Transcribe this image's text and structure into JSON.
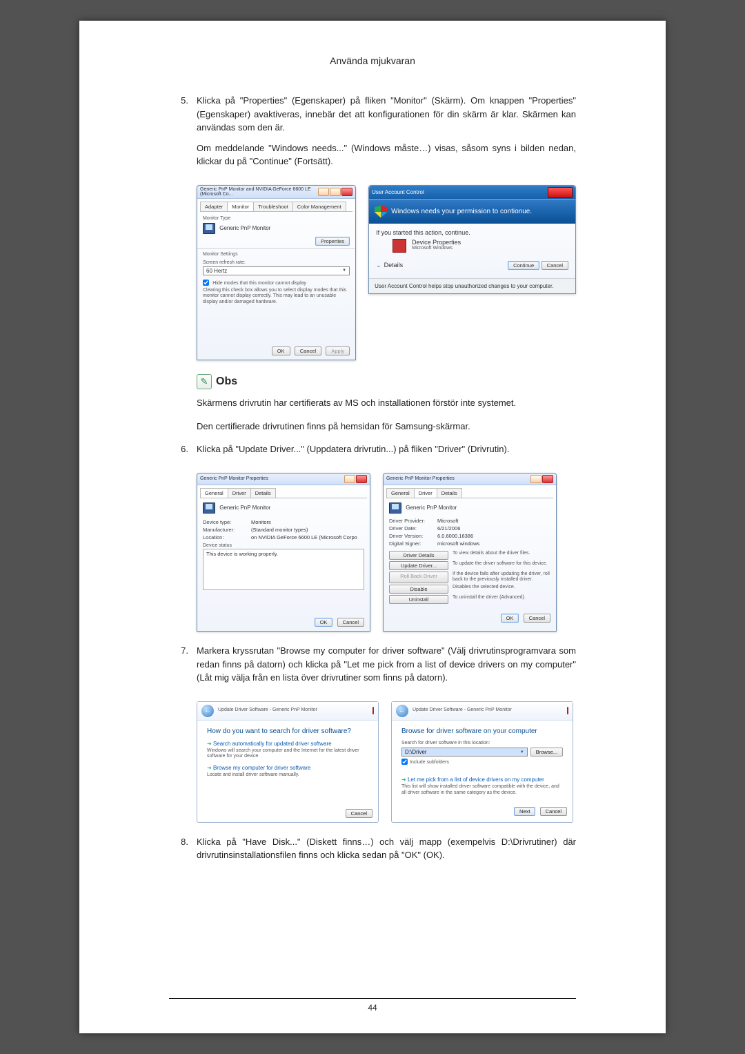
{
  "header": {
    "title": "Använda mjukvaran"
  },
  "steps": {
    "s5": {
      "num": "5.",
      "p1": "Klicka på \"Properties\" (Egenskaper) på fliken \"Monitor\" (Skärm). Om knappen \"Properties\" (Egenskaper) avaktiveras, innebär det att konfigurationen för din skärm är klar. Skärmen kan användas som den är.",
      "p2": "Om meddelande \"Windows needs...\" (Windows måste…) visas, såsom syns i bilden nedan, klickar du på \"Continue\" (Fortsätt)."
    },
    "s6": {
      "num": "6.",
      "p1": "Klicka på \"Update Driver...\" (Uppdatera drivrutin...) på fliken \"Driver\" (Drivrutin)."
    },
    "s7": {
      "num": "7.",
      "p1": "Markera kryssrutan \"Browse my computer for driver software\" (Välj drivrutinsprogramvara som redan finns på datorn) och klicka på \"Let me pick from a list of device drivers on my computer\" (Låt mig välja från en lista över drivrutiner som finns på datorn)."
    },
    "s8": {
      "num": "8.",
      "p1": "Klicka på \"Have Disk...\" (Diskett finns…) och välj mapp (exempelvis D:\\Drivrutiner) där drivrutinsinstallationsfilen finns och klicka sedan på \"OK\" (OK)."
    }
  },
  "note": {
    "label": "Obs",
    "p1": "Skärmens drivrutin har certifierats av MS och installationen förstör inte systemet.",
    "p2": "Den certifierade drivrutinen finns på hemsidan för Samsung-skärmar."
  },
  "page_number": "44",
  "win_monitor": {
    "title": "Generic PnP Monitor and NVIDIA GeForce 6600 LE (Microsoft Co...",
    "tabs": {
      "adapter": "Adapter",
      "monitor": "Monitor",
      "troubleshoot": "Troubleshoot",
      "color": "Color Management"
    },
    "type_label": "Monitor Type",
    "type_value": "Generic PnP Monitor",
    "properties_btn": "Properties",
    "settings_label": "Monitor Settings",
    "refresh_label": "Screen refresh rate:",
    "refresh_value": "60 Hertz",
    "hide_cb": "Hide modes that this monitor cannot display",
    "hide_desc": "Clearing this check box allows you to select display modes that this monitor cannot display correctly. This may lead to an unusable display and/or damaged hardware.",
    "ok": "OK",
    "cancel": "Cancel",
    "apply": "Apply"
  },
  "uac": {
    "title": "User Account Control",
    "headline": "Windows needs your permission to contionue.",
    "sub": "If you started this action, continue.",
    "item1": "Device Properties",
    "item2": "Microsoft Windows",
    "details": "Details",
    "continue": "Continue",
    "cancel": "Cancel",
    "footer": "User Account Control helps stop unauthorized changes to your computer."
  },
  "prop_general": {
    "title": "Generic PnP Monitor Properties",
    "tabs": {
      "general": "General",
      "driver": "Driver",
      "details": "Details"
    },
    "name": "Generic PnP Monitor",
    "dt_l": "Device type:",
    "dt_v": "Monitors",
    "mf_l": "Manufacturer:",
    "mf_v": "(Standard monitor types)",
    "loc_l": "Location:",
    "loc_v": "on NVIDIA GeForce 6600 LE (Microsoft Corpo",
    "status_l": "Device status",
    "status_v": "This device is working properly.",
    "ok": "OK",
    "cancel": "Cancel"
  },
  "prop_driver": {
    "title": "Generic PnP Monitor Properties",
    "tabs": {
      "general": "General",
      "driver": "Driver",
      "details": "Details"
    },
    "name": "Generic PnP Monitor",
    "prov_l": "Driver Provider:",
    "prov_v": "Microsoft",
    "date_l": "Driver Date:",
    "date_v": "6/21/2006",
    "ver_l": "Driver Version:",
    "ver_v": "6.0.6000.16386",
    "sign_l": "Digital Signer:",
    "sign_v": "microsoft windows",
    "b1": "Driver Details",
    "d1": "To view details about the driver files.",
    "b2": "Update Driver...",
    "d2": "To update the driver software for this device.",
    "b3": "Roll Back Driver",
    "d3": "If the device fails after updating the driver, roll back to the previously installed driver.",
    "b4": "Disable",
    "d4": "Disables the selected device.",
    "b5": "Uninstall",
    "d5": "To uninstall the driver (Advanced).",
    "ok": "OK",
    "cancel": "Cancel"
  },
  "wiz_left": {
    "crumb": "Update Driver Software - Generic PnP Monitor",
    "heading": "How do you want to search for driver software?",
    "opt1": "Search automatically for updated driver software",
    "opt1_desc": "Windows will search your computer and the Internet for the latest driver software for your device.",
    "opt2": "Browse my computer for driver software",
    "opt2_desc": "Locate and install driver software manually.",
    "cancel": "Cancel"
  },
  "wiz_right": {
    "crumb": "Update Driver Software - Generic PnP Monitor",
    "heading": "Browse for driver software on your computer",
    "search_lbl": "Search for driver software in this location:",
    "path": "D:\\Driver",
    "browse": "Browse...",
    "include": "Include subfolders",
    "opt": "Let me pick from a list of device drivers on my computer",
    "opt_desc": "This list will show installed driver software compatible with the device, and all driver software in the same category as the device.",
    "next": "Next",
    "cancel": "Cancel"
  }
}
